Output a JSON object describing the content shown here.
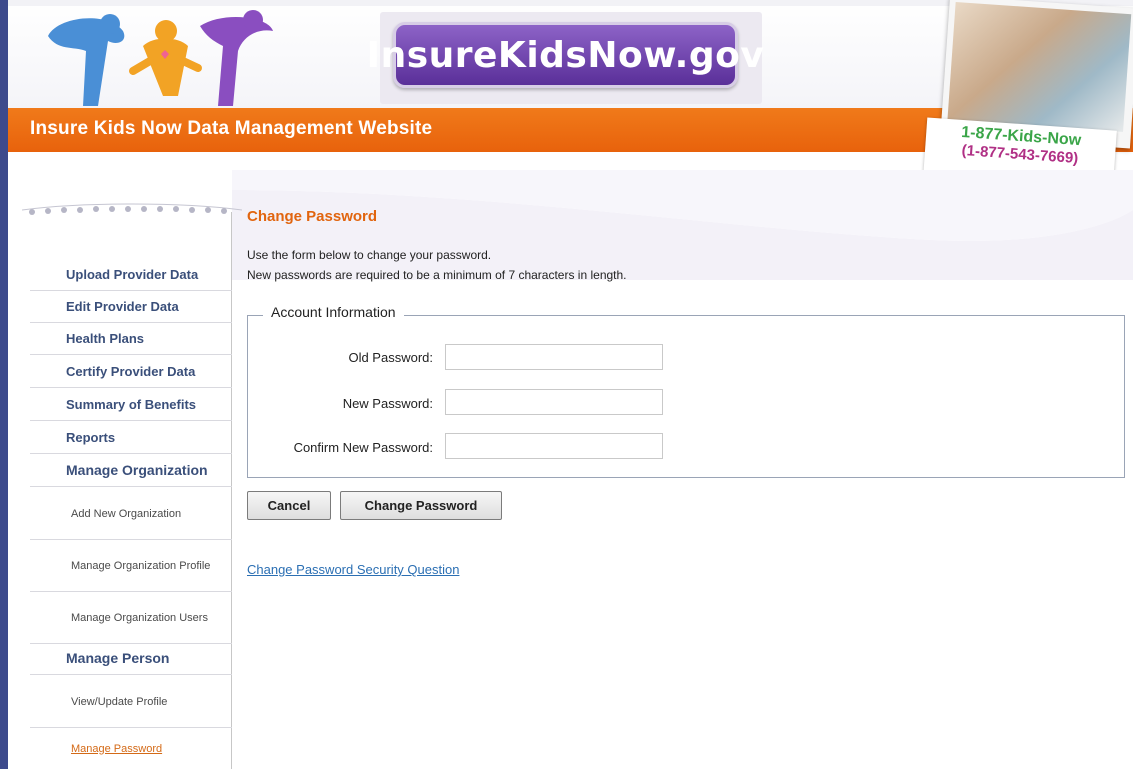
{
  "header": {
    "brand": "InsureKidsNow.gov",
    "site_title": "Insure Kids Now Data Management Website",
    "phone_line1": "1-877-Kids-Now",
    "phone_line2": "(1-877-543-7669)"
  },
  "sidebar": {
    "items": [
      {
        "label": "Upload Provider Data"
      },
      {
        "label": "Edit Provider Data"
      },
      {
        "label": "Health Plans"
      },
      {
        "label": "Certify Provider Data"
      },
      {
        "label": "Summary of Benefits"
      },
      {
        "label": "Reports"
      },
      {
        "label": "Manage Organization"
      }
    ],
    "org_subitems": [
      {
        "label": "Add New Organization"
      },
      {
        "label": "Manage Organization Profile"
      },
      {
        "label": "Manage Organization Users"
      }
    ],
    "person_section": "Manage Person",
    "person_subitems": [
      {
        "label": "View/Update Profile"
      },
      {
        "label": "Manage Password"
      }
    ]
  },
  "main": {
    "title": "Change Password",
    "intro_line1": "Use the form below to change your password.",
    "intro_line2": "New passwords are required to be a minimum of 7 characters in length.",
    "fieldset_legend": "Account Information",
    "fields": {
      "old_password_label": "Old Password:",
      "old_password_value": "",
      "new_password_label": "New Password:",
      "new_password_value": "",
      "confirm_password_label": "Confirm New Password:",
      "confirm_password_value": ""
    },
    "cancel_label": "Cancel",
    "submit_label": "Change Password",
    "security_link": "Change Password Security Question"
  },
  "colors": {
    "orange": "#e8620c",
    "purple": "#6a3ca8",
    "nav_text": "#3a4f7a",
    "title_orange": "#e1650f",
    "link_blue": "#2b6fb3"
  }
}
